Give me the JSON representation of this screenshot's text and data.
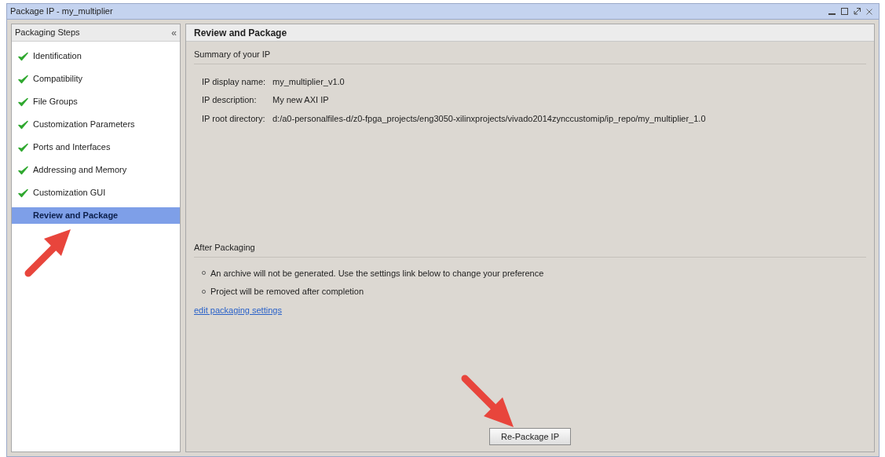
{
  "window": {
    "title": "Package IP - my_multiplier"
  },
  "sidebar": {
    "title": "Packaging Steps",
    "collapse": "«",
    "items": [
      {
        "label": "Identification",
        "done": true,
        "selected": false
      },
      {
        "label": "Compatibility",
        "done": true,
        "selected": false
      },
      {
        "label": "File Groups",
        "done": true,
        "selected": false
      },
      {
        "label": "Customization Parameters",
        "done": true,
        "selected": false
      },
      {
        "label": "Ports and Interfaces",
        "done": true,
        "selected": false
      },
      {
        "label": "Addressing and Memory",
        "done": true,
        "selected": false
      },
      {
        "label": "Customization GUI",
        "done": true,
        "selected": false
      },
      {
        "label": "Review and Package",
        "done": false,
        "selected": true
      }
    ]
  },
  "main": {
    "title": "Review and Package",
    "summary": {
      "heading": "Summary of your IP",
      "fields": [
        {
          "label": "IP display name:",
          "value": "my_multiplier_v1.0"
        },
        {
          "label": "IP description:",
          "value": "My new AXI IP"
        },
        {
          "label": "IP root directory:",
          "value": "d:/a0-personalfiles-d/z0-fpga_projects/eng3050-xilinxprojects/vivado2014zynccustomip/ip_repo/my_multiplier_1.0"
        }
      ]
    },
    "after": {
      "heading": "After Packaging",
      "bullets": [
        "An archive will not be generated. Use the settings link below to change your preference",
        "Project will be removed after completion"
      ],
      "link": "edit packaging settings"
    },
    "button": "Re-Package IP"
  }
}
